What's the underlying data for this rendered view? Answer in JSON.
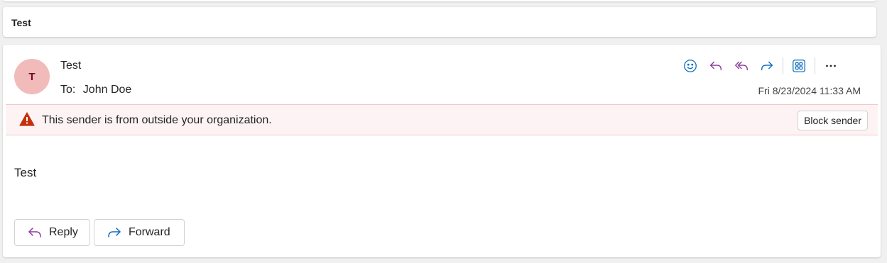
{
  "subject": "Test",
  "message": {
    "avatar_initial": "T",
    "sender": "Test",
    "to_label": "To:",
    "to_name": "John Doe",
    "datetime": "Fri 8/23/2024 11:33 AM",
    "body": "Test"
  },
  "toolbar": {
    "icons": [
      "emoji-icon",
      "reply-icon",
      "reply-all-icon",
      "forward-icon",
      "apps-icon",
      "more-icon"
    ],
    "more_label": "···"
  },
  "warning": {
    "text": "This sender is from outside your organization.",
    "block_label": "Block sender"
  },
  "actions": {
    "reply_label": "Reply",
    "forward_label": "Forward"
  },
  "colors": {
    "accent_blue": "#0f6cbd",
    "reply_purple": "#8a3b9a",
    "avatar_bg": "#f1bbbc",
    "avatar_text": "#750b1c",
    "warning_bg": "#fdf3f4",
    "warning_icon": "#c4310c"
  }
}
